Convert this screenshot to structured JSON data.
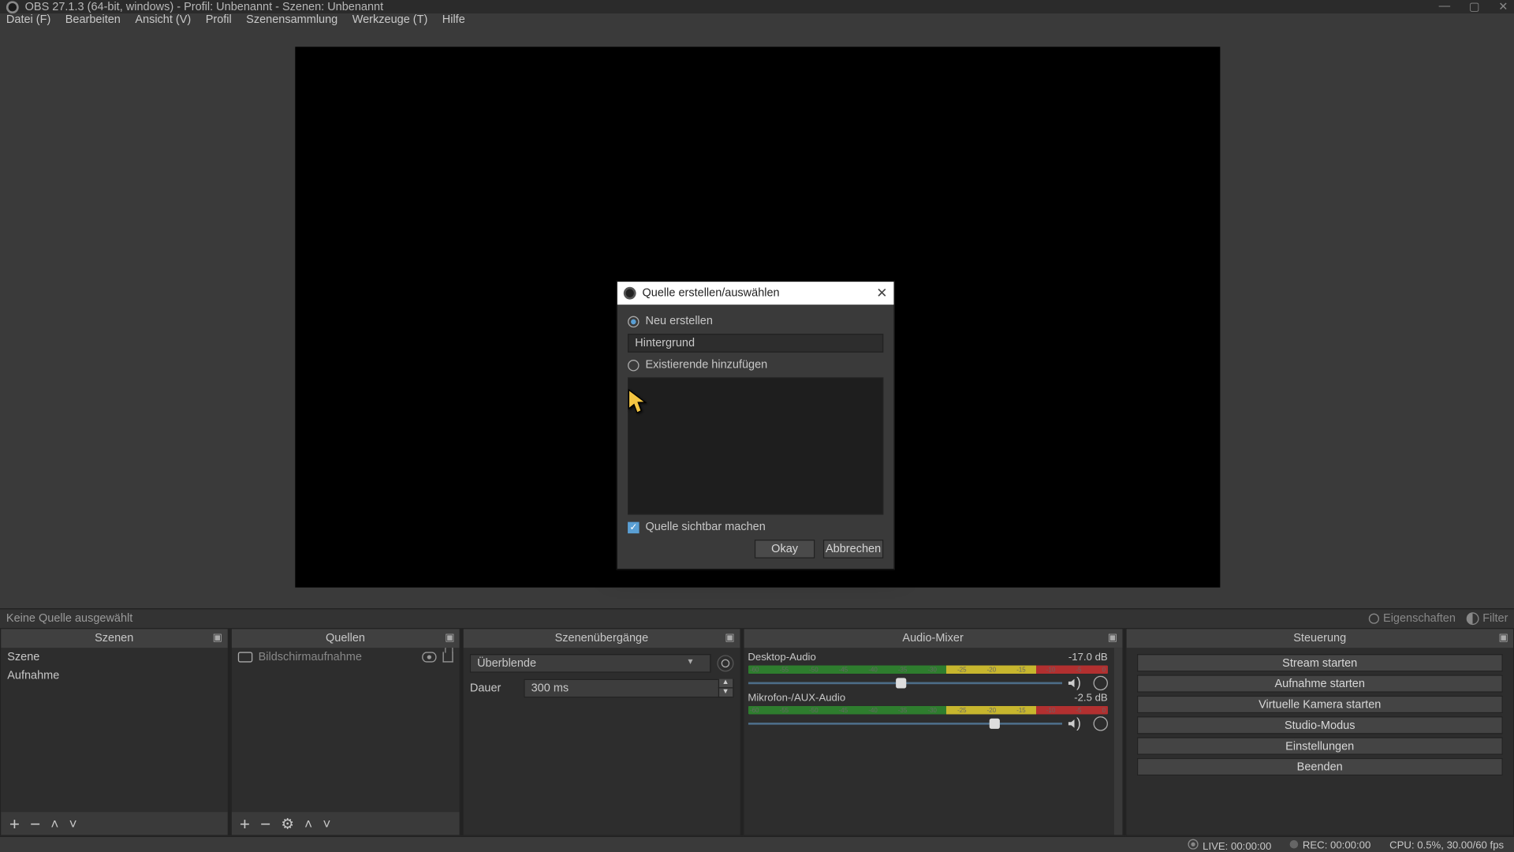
{
  "titlebar": {
    "text": "OBS 27.1.3 (64-bit, windows) - Profil: Unbenannt - Szenen: Unbenannt"
  },
  "menu": {
    "items": [
      "Datei (F)",
      "Bearbeiten",
      "Ansicht (V)",
      "Profil",
      "Szenensammlung",
      "Werkzeuge (T)",
      "Hilfe"
    ]
  },
  "statusrow": {
    "selection": "Keine Quelle ausgewählt",
    "properties": "Eigenschaften",
    "filter": "Filter"
  },
  "docks": {
    "scenes": {
      "title": "Szenen",
      "items": [
        "Szene",
        "Aufnahme"
      ]
    },
    "sources": {
      "title": "Quellen",
      "items": [
        {
          "name": "Bildschirmaufnahme"
        }
      ]
    },
    "transitions": {
      "title": "Szenenübergänge",
      "selected": "Überblende",
      "duration_label": "Dauer",
      "duration_value": "300 ms"
    },
    "mixer": {
      "title": "Audio-Mixer",
      "tracks": [
        {
          "name": "Desktop-Audio",
          "db": "-17.0 dB",
          "knob_pct": 47,
          "fill_pct": 100
        },
        {
          "name": "Mikrofon-/AUX-Audio",
          "db": "-2.5 dB",
          "knob_pct": 77,
          "fill_pct": 100
        }
      ],
      "ticks": [
        "-60",
        "-55",
        "-50",
        "-45",
        "-40",
        "-35",
        "-30",
        "-25",
        "-20",
        "-15",
        "-10",
        "-5",
        "0"
      ]
    },
    "controls": {
      "title": "Steuerung",
      "buttons": [
        "Stream starten",
        "Aufnahme starten",
        "Virtuelle Kamera starten",
        "Studio-Modus",
        "Einstellungen",
        "Beenden"
      ]
    }
  },
  "bottombar": {
    "live": "LIVE: 00:00:00",
    "rec": "REC: 00:00:00",
    "cpu": "CPU: 0.5%, 30.00/60 fps"
  },
  "dialog": {
    "title": "Quelle erstellen/auswählen",
    "radio_new": "Neu erstellen",
    "name_value": "Hintergrund",
    "radio_existing": "Existierende hinzufügen",
    "check_visible": "Quelle sichtbar machen",
    "ok": "Okay",
    "cancel": "Abbrechen"
  },
  "icons": {
    "plus": "+",
    "minus": "−",
    "gear": "⚙",
    "up": "˄",
    "down": "˅",
    "pop": "⌂"
  }
}
